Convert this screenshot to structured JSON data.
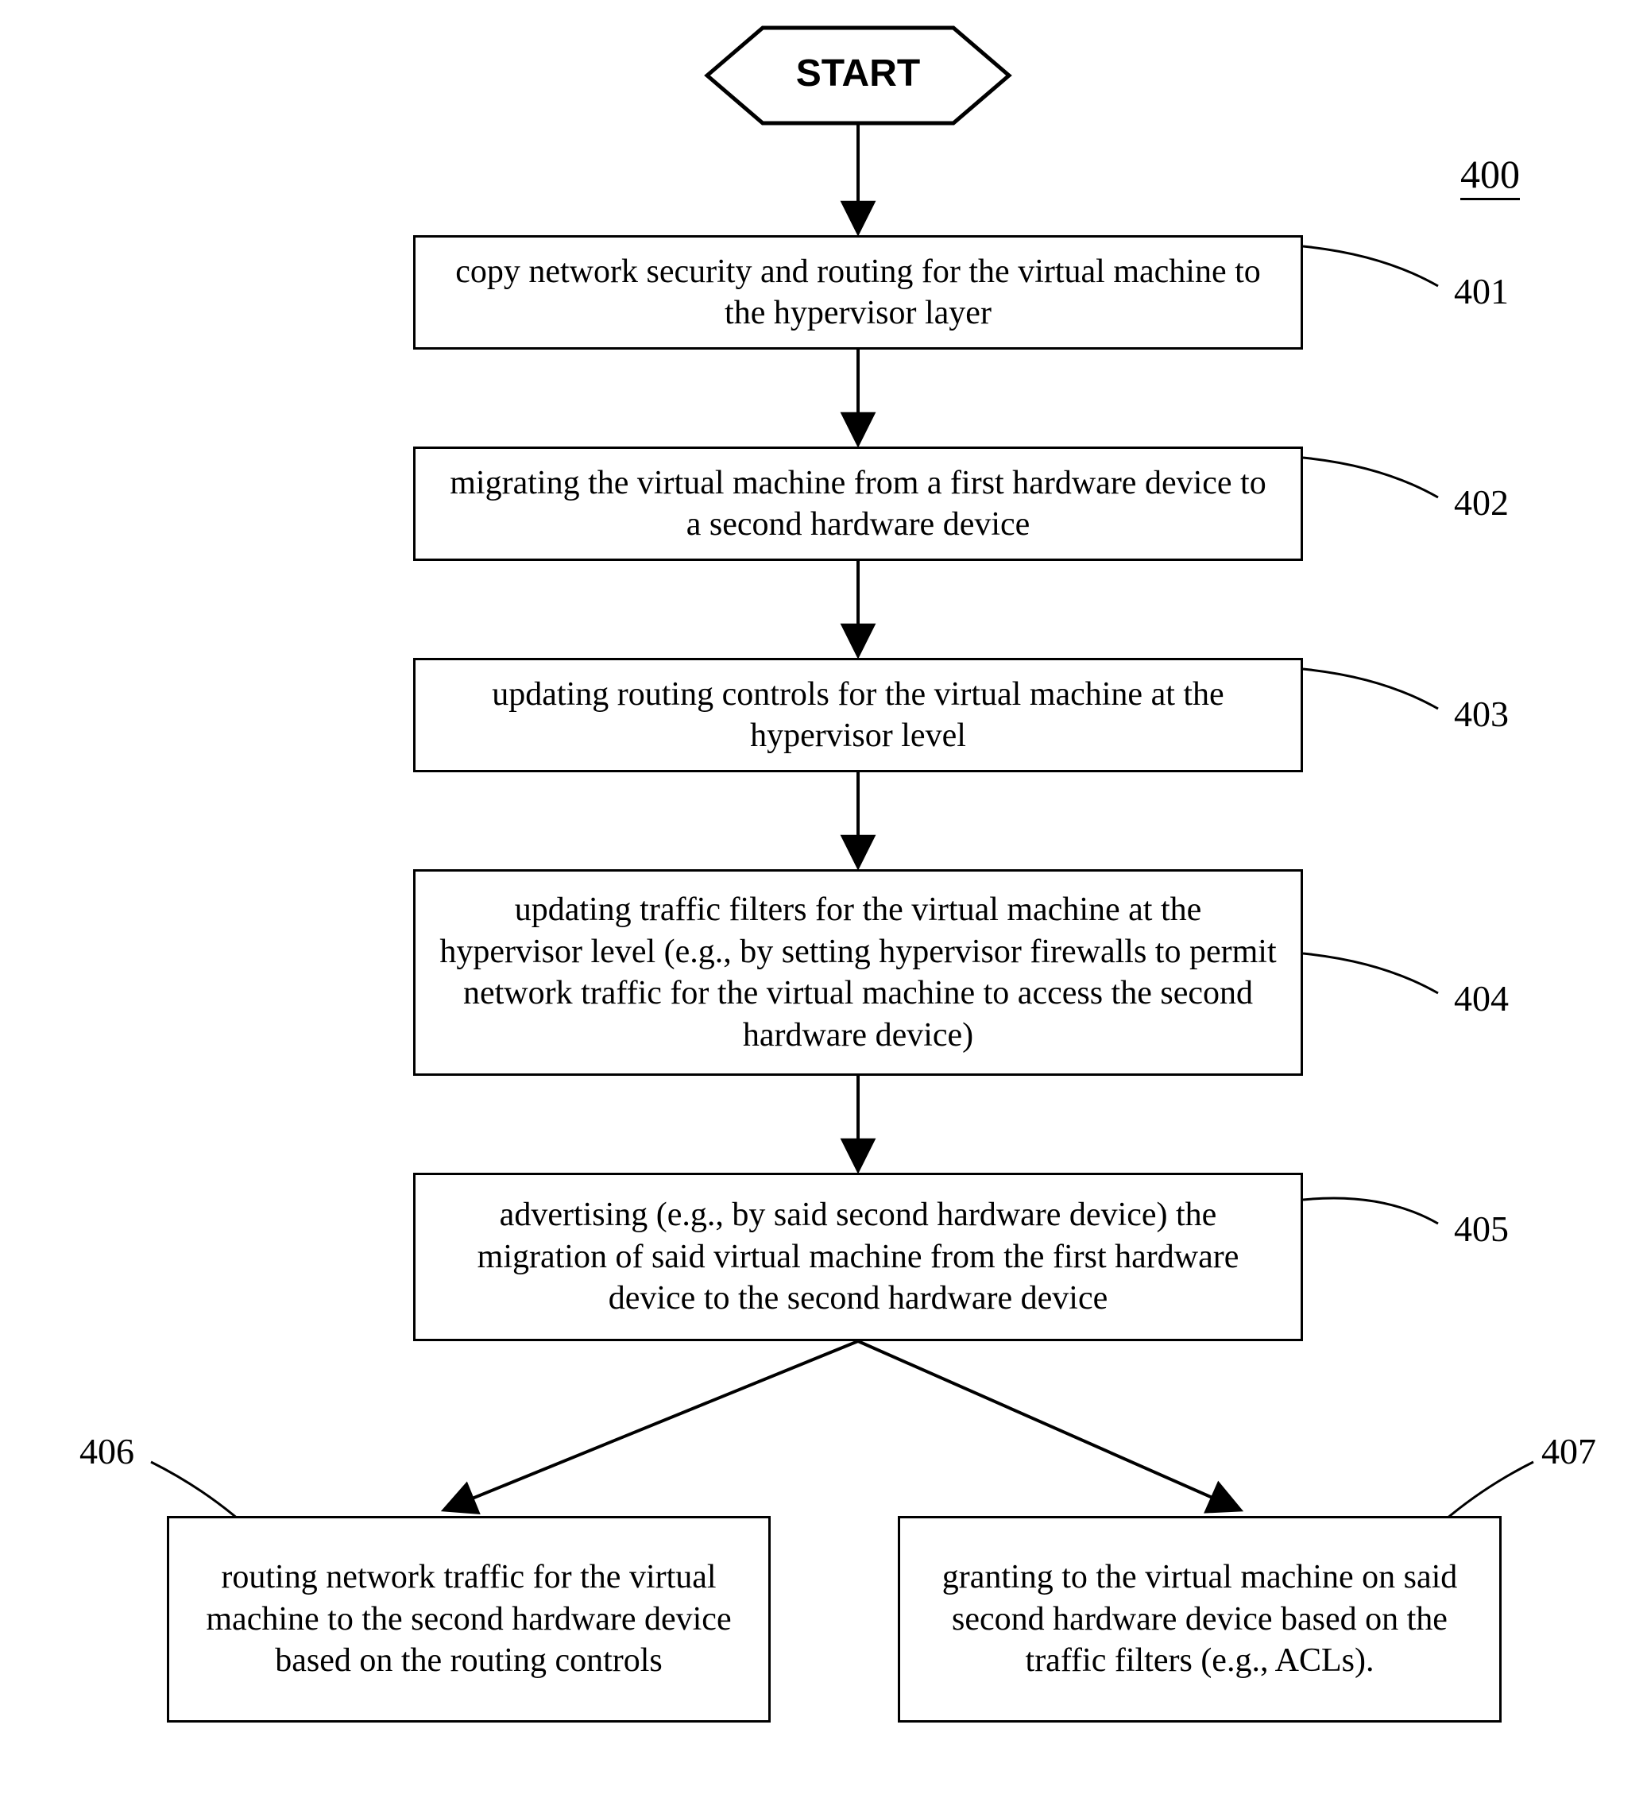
{
  "figure_label": "400",
  "start": "START",
  "steps": {
    "s401": {
      "num": "401",
      "text": "copy network security and routing for the virtual machine to the hypervisor layer"
    },
    "s402": {
      "num": "402",
      "text": "migrating the virtual machine from a first hardware device to a second hardware device"
    },
    "s403": {
      "num": "403",
      "text": "updating routing controls for the virtual machine at the hypervisor level"
    },
    "s404": {
      "num": "404",
      "text": "updating traffic filters for the virtual machine at the hypervisor level (e.g., by setting hypervisor firewalls to permit network traffic for the virtual machine to access the second hardware device)"
    },
    "s405": {
      "num": "405",
      "text": "advertising (e.g., by said second hardware device) the migration of said virtual machine from the first hardware device to the second hardware device"
    },
    "s406": {
      "num": "406",
      "text": "routing network traffic for the virtual machine to the second hardware device based on the routing controls"
    },
    "s407": {
      "num": "407",
      "text": "granting to the virtual machine on said second hardware device based on the traffic filters (e.g., ACLs)."
    }
  }
}
